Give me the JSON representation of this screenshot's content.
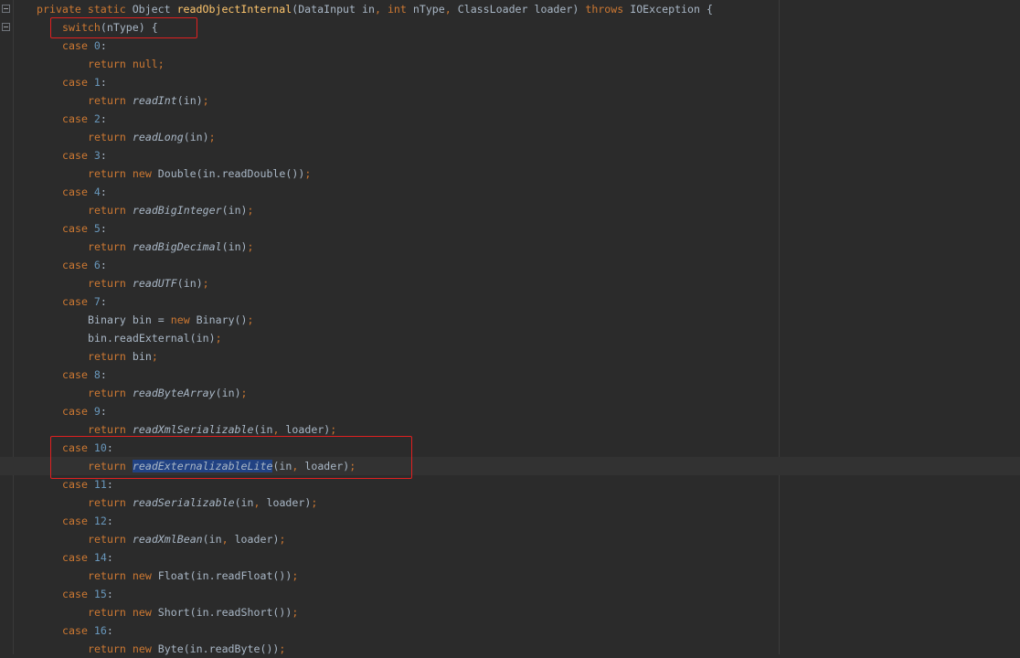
{
  "lines": [
    {
      "indent": 1,
      "tokens": [
        {
          "t": "private static ",
          "c": "kw"
        },
        {
          "t": "Object "
        },
        {
          "t": "readObjectInternal",
          "c": "fn"
        },
        {
          "t": "(DataInput in"
        },
        {
          "t": ", ",
          "c": "kw"
        },
        {
          "t": "int ",
          "c": "kw"
        },
        {
          "t": "nType"
        },
        {
          "t": ", ",
          "c": "kw"
        },
        {
          "t": "ClassLoader loader) "
        },
        {
          "t": "throws ",
          "c": "kw"
        },
        {
          "t": "IOException {"
        }
      ]
    },
    {
      "indent": 2,
      "tokens": [
        {
          "t": "switch",
          "c": "kw"
        },
        {
          "t": "(nType) {"
        }
      ]
    },
    {
      "indent": 2,
      "tokens": [
        {
          "t": "case ",
          "c": "kw"
        },
        {
          "t": "0",
          "c": "num"
        },
        {
          "t": ":"
        }
      ]
    },
    {
      "indent": 3,
      "tokens": [
        {
          "t": "return null;",
          "c": "kw"
        }
      ]
    },
    {
      "indent": 2,
      "tokens": [
        {
          "t": "case ",
          "c": "kw"
        },
        {
          "t": "1",
          "c": "num"
        },
        {
          "t": ":"
        }
      ]
    },
    {
      "indent": 3,
      "tokens": [
        {
          "t": "return ",
          "c": "kw"
        },
        {
          "t": "readInt",
          "c": "it"
        },
        {
          "t": "(in)"
        },
        {
          "t": ";",
          "c": "kw"
        }
      ]
    },
    {
      "indent": 2,
      "tokens": [
        {
          "t": "case ",
          "c": "kw"
        },
        {
          "t": "2",
          "c": "num"
        },
        {
          "t": ":"
        }
      ]
    },
    {
      "indent": 3,
      "tokens": [
        {
          "t": "return ",
          "c": "kw"
        },
        {
          "t": "readLong",
          "c": "it"
        },
        {
          "t": "(in)"
        },
        {
          "t": ";",
          "c": "kw"
        }
      ]
    },
    {
      "indent": 2,
      "tokens": [
        {
          "t": "case ",
          "c": "kw"
        },
        {
          "t": "3",
          "c": "num"
        },
        {
          "t": ":"
        }
      ]
    },
    {
      "indent": 3,
      "tokens": [
        {
          "t": "return new ",
          "c": "kw"
        },
        {
          "t": "Double(in.readDouble())"
        },
        {
          "t": ";",
          "c": "kw"
        }
      ]
    },
    {
      "indent": 2,
      "tokens": [
        {
          "t": "case ",
          "c": "kw"
        },
        {
          "t": "4",
          "c": "num"
        },
        {
          "t": ":"
        }
      ]
    },
    {
      "indent": 3,
      "tokens": [
        {
          "t": "return ",
          "c": "kw"
        },
        {
          "t": "readBigInteger",
          "c": "it"
        },
        {
          "t": "(in)"
        },
        {
          "t": ";",
          "c": "kw"
        }
      ]
    },
    {
      "indent": 2,
      "tokens": [
        {
          "t": "case ",
          "c": "kw"
        },
        {
          "t": "5",
          "c": "num"
        },
        {
          "t": ":"
        }
      ]
    },
    {
      "indent": 3,
      "tokens": [
        {
          "t": "return ",
          "c": "kw"
        },
        {
          "t": "readBigDecimal",
          "c": "it"
        },
        {
          "t": "(in)"
        },
        {
          "t": ";",
          "c": "kw"
        }
      ]
    },
    {
      "indent": 2,
      "tokens": [
        {
          "t": "case ",
          "c": "kw"
        },
        {
          "t": "6",
          "c": "num"
        },
        {
          "t": ":"
        }
      ]
    },
    {
      "indent": 3,
      "tokens": [
        {
          "t": "return ",
          "c": "kw"
        },
        {
          "t": "readUTF",
          "c": "it"
        },
        {
          "t": "(in)"
        },
        {
          "t": ";",
          "c": "kw"
        }
      ]
    },
    {
      "indent": 2,
      "tokens": [
        {
          "t": "case ",
          "c": "kw"
        },
        {
          "t": "7",
          "c": "num"
        },
        {
          "t": ":"
        }
      ]
    },
    {
      "indent": 3,
      "tokens": [
        {
          "t": "Binary bin = "
        },
        {
          "t": "new ",
          "c": "kw"
        },
        {
          "t": "Binary()"
        },
        {
          "t": ";",
          "c": "kw"
        }
      ]
    },
    {
      "indent": 3,
      "tokens": [
        {
          "t": "bin.readExternal(in)"
        },
        {
          "t": ";",
          "c": "kw"
        }
      ]
    },
    {
      "indent": 3,
      "tokens": [
        {
          "t": "return ",
          "c": "kw"
        },
        {
          "t": "bin"
        },
        {
          "t": ";",
          "c": "kw"
        }
      ]
    },
    {
      "indent": 2,
      "tokens": [
        {
          "t": "case ",
          "c": "kw"
        },
        {
          "t": "8",
          "c": "num"
        },
        {
          "t": ":"
        }
      ]
    },
    {
      "indent": 3,
      "tokens": [
        {
          "t": "return ",
          "c": "kw"
        },
        {
          "t": "readByteArray",
          "c": "it"
        },
        {
          "t": "(in)"
        },
        {
          "t": ";",
          "c": "kw"
        }
      ]
    },
    {
      "indent": 2,
      "tokens": [
        {
          "t": "case ",
          "c": "kw"
        },
        {
          "t": "9",
          "c": "num"
        },
        {
          "t": ":"
        }
      ]
    },
    {
      "indent": 3,
      "tokens": [
        {
          "t": "return ",
          "c": "kw"
        },
        {
          "t": "readXmlSerializable",
          "c": "it"
        },
        {
          "t": "(in"
        },
        {
          "t": ", ",
          "c": "kw"
        },
        {
          "t": "loader)"
        },
        {
          "t": ";",
          "c": "kw"
        }
      ]
    },
    {
      "indent": 2,
      "tokens": [
        {
          "t": "case ",
          "c": "kw"
        },
        {
          "t": "10",
          "c": "num"
        },
        {
          "t": ":"
        }
      ]
    },
    {
      "indent": 3,
      "current": true,
      "tokens": [
        {
          "t": "return ",
          "c": "kw"
        },
        {
          "t": "readExternalizableLite",
          "c": "it sel"
        },
        {
          "t": "(in"
        },
        {
          "t": ", ",
          "c": "kw"
        },
        {
          "t": "loader)"
        },
        {
          "t": ";",
          "c": "kw"
        }
      ]
    },
    {
      "indent": 2,
      "tokens": [
        {
          "t": "case ",
          "c": "kw"
        },
        {
          "t": "11",
          "c": "num"
        },
        {
          "t": ":"
        }
      ]
    },
    {
      "indent": 3,
      "tokens": [
        {
          "t": "return ",
          "c": "kw"
        },
        {
          "t": "readSerializable",
          "c": "it"
        },
        {
          "t": "(in"
        },
        {
          "t": ", ",
          "c": "kw"
        },
        {
          "t": "loader)"
        },
        {
          "t": ";",
          "c": "kw"
        }
      ]
    },
    {
      "indent": 2,
      "tokens": [
        {
          "t": "case ",
          "c": "kw"
        },
        {
          "t": "12",
          "c": "num"
        },
        {
          "t": ":"
        }
      ]
    },
    {
      "indent": 3,
      "tokens": [
        {
          "t": "return ",
          "c": "kw"
        },
        {
          "t": "readXmlBean",
          "c": "it"
        },
        {
          "t": "(in"
        },
        {
          "t": ", ",
          "c": "kw"
        },
        {
          "t": "loader)"
        },
        {
          "t": ";",
          "c": "kw"
        }
      ]
    },
    {
      "indent": 2,
      "tokens": [
        {
          "t": "case ",
          "c": "kw"
        },
        {
          "t": "14",
          "c": "num"
        },
        {
          "t": ":"
        }
      ]
    },
    {
      "indent": 3,
      "tokens": [
        {
          "t": "return new ",
          "c": "kw"
        },
        {
          "t": "Float(in.readFloat())"
        },
        {
          "t": ";",
          "c": "kw"
        }
      ]
    },
    {
      "indent": 2,
      "tokens": [
        {
          "t": "case ",
          "c": "kw"
        },
        {
          "t": "15",
          "c": "num"
        },
        {
          "t": ":"
        }
      ]
    },
    {
      "indent": 3,
      "tokens": [
        {
          "t": "return new ",
          "c": "kw"
        },
        {
          "t": "Short(in.readShort())"
        },
        {
          "t": ";",
          "c": "kw"
        }
      ]
    },
    {
      "indent": 2,
      "tokens": [
        {
          "t": "case ",
          "c": "kw"
        },
        {
          "t": "16",
          "c": "num"
        },
        {
          "t": ":"
        }
      ]
    },
    {
      "indent": 3,
      "tokens": [
        {
          "t": "return new ",
          "c": "kw"
        },
        {
          "t": "Byte(in.readByte())"
        },
        {
          "t": ";",
          "c": "kw"
        }
      ]
    }
  ],
  "colors": {
    "background": "#2b2b2b",
    "keyword": "#cc7832",
    "number": "#6897bb",
    "method_declaration": "#ffc66d",
    "identifier": "#a9b7c6",
    "selection": "#214283",
    "annotation_box": "#e02020"
  },
  "icons": [
    "fold-icon"
  ]
}
